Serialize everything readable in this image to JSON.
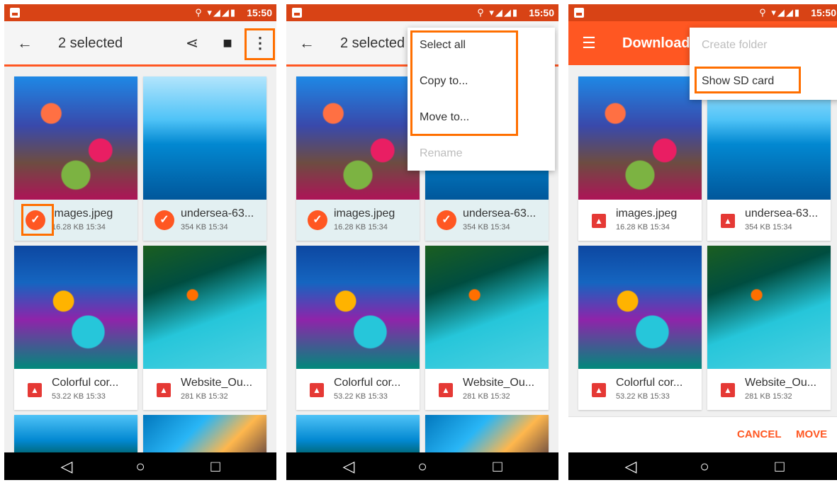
{
  "status": {
    "time": "15:50",
    "icons": "⚲ ▾◢◢▮"
  },
  "colors": {
    "accent": "#ff5722",
    "status_bar": "#d84315",
    "highlight": "#ff6f00"
  },
  "screen1": {
    "title": "2 selected",
    "back_icon": "arrow-left-icon",
    "share_icon": "share-icon",
    "delete_icon": "trash-icon",
    "more_icon": "more-vert-icon"
  },
  "screen2": {
    "title": "2 selected",
    "menu": [
      "Select all",
      "Copy to...",
      "Move to...",
      "Rename"
    ]
  },
  "screen3": {
    "title": "Download",
    "menu": [
      "Create folder",
      "Show SD card"
    ],
    "cancel": "CANCEL",
    "move": "MOVE"
  },
  "files": [
    {
      "name": "images.jpeg",
      "meta": "16.28 KB 15:34"
    },
    {
      "name": "undersea-63...",
      "meta": "354 KB 15:34"
    },
    {
      "name": "Colorful cor...",
      "meta": "53.22 KB 15:33"
    },
    {
      "name": "Website_Ou...",
      "meta": "281 KB 15:32"
    }
  ]
}
